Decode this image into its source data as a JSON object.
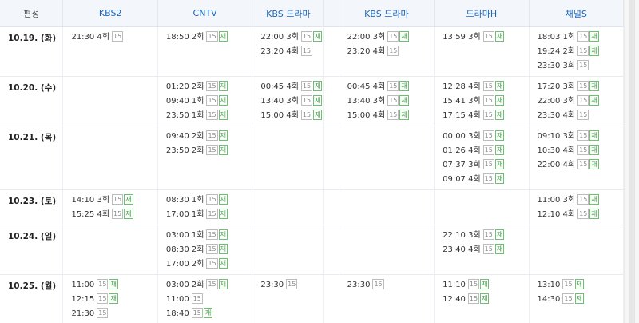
{
  "columns": [
    {
      "key": "date",
      "label": "편성"
    },
    {
      "key": "kbs2",
      "label": "KBS2"
    },
    {
      "key": "cntv",
      "label": "CNTV"
    },
    {
      "key": "kbsd1",
      "label": "KBS 드라마"
    },
    {
      "key": "kbsd2",
      "label": "KBS 드라마"
    },
    {
      "key": "dramah",
      "label": "드라마H"
    },
    {
      "key": "chs",
      "label": "채널S"
    }
  ],
  "rows": [
    {
      "date": "10.19. (화)",
      "height": 62,
      "cells": {
        "kbs2": [
          {
            "time": "21:30",
            "ep": "4회",
            "rating": "15",
            "rerun": false
          }
        ],
        "cntv": [
          {
            "time": "18:50",
            "ep": "2회",
            "rating": "15",
            "rerun": true
          }
        ],
        "kbsd1": [
          {
            "time": "22:00",
            "ep": "3회",
            "rating": "15",
            "rerun": true
          },
          {
            "time": "23:20",
            "ep": "4회",
            "rating": "15",
            "rerun": false
          }
        ],
        "kbsd2": [
          {
            "time": "22:00",
            "ep": "3회",
            "rating": "15",
            "rerun": true
          },
          {
            "time": "23:20",
            "ep": "4회",
            "rating": "15",
            "rerun": false
          }
        ],
        "dramah": [
          {
            "time": "13:59",
            "ep": "3회",
            "rating": "15",
            "rerun": true
          }
        ],
        "chs": [
          {
            "time": "18:03",
            "ep": "1회",
            "rating": "15",
            "rerun": true
          },
          {
            "time": "19:24",
            "ep": "2회",
            "rating": "15",
            "rerun": true
          },
          {
            "time": "23:30",
            "ep": "3회",
            "rating": "15",
            "rerun": false
          }
        ]
      }
    },
    {
      "date": "10.20. (수)",
      "height": 62,
      "cells": {
        "kbs2": [],
        "cntv": [
          {
            "time": "01:20",
            "ep": "2회",
            "rating": "15",
            "rerun": true
          },
          {
            "time": "09:40",
            "ep": "1회",
            "rating": "15",
            "rerun": true
          },
          {
            "time": "23:50",
            "ep": "1회",
            "rating": "15",
            "rerun": true
          }
        ],
        "kbsd1": [
          {
            "time": "00:45",
            "ep": "4회",
            "rating": "15",
            "rerun": true
          },
          {
            "time": "13:40",
            "ep": "3회",
            "rating": "15",
            "rerun": true
          },
          {
            "time": "15:00",
            "ep": "4회",
            "rating": "15",
            "rerun": true
          }
        ],
        "kbsd2": [
          {
            "time": "00:45",
            "ep": "4회",
            "rating": "15",
            "rerun": true
          },
          {
            "time": "13:40",
            "ep": "3회",
            "rating": "15",
            "rerun": true
          },
          {
            "time": "15:00",
            "ep": "4회",
            "rating": "15",
            "rerun": true
          }
        ],
        "dramah": [
          {
            "time": "12:28",
            "ep": "4회",
            "rating": "15",
            "rerun": true
          },
          {
            "time": "15:41",
            "ep": "3회",
            "rating": "15",
            "rerun": true
          },
          {
            "time": "17:15",
            "ep": "4회",
            "rating": "15",
            "rerun": true
          }
        ],
        "chs": [
          {
            "time": "17:20",
            "ep": "3회",
            "rating": "15",
            "rerun": true
          },
          {
            "time": "22:00",
            "ep": "3회",
            "rating": "15",
            "rerun": true
          },
          {
            "time": "23:30",
            "ep": "4회",
            "rating": "15",
            "rerun": false
          }
        ]
      }
    },
    {
      "date": "10.21. (목)",
      "height": 80,
      "cells": {
        "kbs2": [],
        "cntv": [
          {
            "time": "09:40",
            "ep": "2회",
            "rating": "15",
            "rerun": true
          },
          {
            "time": "23:50",
            "ep": "2회",
            "rating": "15",
            "rerun": true
          }
        ],
        "kbsd1": [],
        "kbsd2": [],
        "dramah": [
          {
            "time": "00:00",
            "ep": "3회",
            "rating": "15",
            "rerun": true
          },
          {
            "time": "01:26",
            "ep": "4회",
            "rating": "15",
            "rerun": true
          },
          {
            "time": "07:37",
            "ep": "3회",
            "rating": "15",
            "rerun": true
          },
          {
            "time": "09:07",
            "ep": "4회",
            "rating": "15",
            "rerun": true
          }
        ],
        "chs": [
          {
            "time": "09:10",
            "ep": "3회",
            "rating": "15",
            "rerun": true
          },
          {
            "time": "10:30",
            "ep": "4회",
            "rating": "15",
            "rerun": true
          },
          {
            "time": "22:00",
            "ep": "4회",
            "rating": "15",
            "rerun": true
          }
        ]
      }
    },
    {
      "date": "10.23. (토)",
      "height": 44,
      "cells": {
        "kbs2": [
          {
            "time": "14:10",
            "ep": "3회",
            "rating": "15",
            "rerun": true
          },
          {
            "time": "15:25",
            "ep": "4회",
            "rating": "15",
            "rerun": true
          }
        ],
        "cntv": [
          {
            "time": "08:30",
            "ep": "1회",
            "rating": "15",
            "rerun": true
          },
          {
            "time": "17:00",
            "ep": "1회",
            "rating": "15",
            "rerun": true
          }
        ],
        "kbsd1": [],
        "kbsd2": [],
        "dramah": [],
        "chs": [
          {
            "time": "11:00",
            "ep": "3회",
            "rating": "15",
            "rerun": true
          },
          {
            "time": "12:10",
            "ep": "4회",
            "rating": "15",
            "rerun": true
          }
        ]
      }
    },
    {
      "date": "10.24. (일)",
      "height": 62,
      "cells": {
        "kbs2": [],
        "cntv": [
          {
            "time": "03:00",
            "ep": "1회",
            "rating": "15",
            "rerun": true
          },
          {
            "time": "08:30",
            "ep": "2회",
            "rating": "15",
            "rerun": true
          },
          {
            "time": "17:00",
            "ep": "2회",
            "rating": "15",
            "rerun": true
          }
        ],
        "kbsd1": [],
        "kbsd2": [],
        "dramah": [
          {
            "time": "22:10",
            "ep": "3회",
            "rating": "15",
            "rerun": true
          },
          {
            "time": "23:40",
            "ep": "4회",
            "rating": "15",
            "rerun": true
          }
        ],
        "chs": []
      }
    },
    {
      "date": "10.25. (월)",
      "height": 62,
      "cells": {
        "kbs2": [
          {
            "time": "11:00",
            "ep": "",
            "rating": "15",
            "rerun": true
          },
          {
            "time": "12:15",
            "ep": "",
            "rating": "15",
            "rerun": true
          },
          {
            "time": "21:30",
            "ep": "",
            "rating": "15",
            "rerun": false
          }
        ],
        "cntv": [
          {
            "time": "03:00",
            "ep": "2회",
            "rating": "15",
            "rerun": true
          },
          {
            "time": "11:00",
            "ep": "",
            "rating": "15",
            "rerun": false
          },
          {
            "time": "18:40",
            "ep": "",
            "rating": "15",
            "rerun": true
          }
        ],
        "kbsd1": [
          {
            "time": "23:30",
            "ep": "",
            "rating": "15",
            "rerun": false
          }
        ],
        "kbsd2": [
          {
            "time": "23:30",
            "ep": "",
            "rating": "15",
            "rerun": false
          }
        ],
        "dramah": [
          {
            "time": "11:10",
            "ep": "",
            "rating": "15",
            "rerun": true
          },
          {
            "time": "12:40",
            "ep": "",
            "rating": "15",
            "rerun": true
          }
        ],
        "chs": [
          {
            "time": "13:10",
            "ep": "",
            "rating": "15",
            "rerun": true
          },
          {
            "time": "14:30",
            "ep": "",
            "rating": "15",
            "rerun": true
          }
        ]
      }
    }
  ],
  "rerun_label": "재",
  "colors": {
    "header_text": "#1a68c2",
    "header_bg": "#f3f7fc",
    "rerun": "#3f9e44",
    "rating_border": "#bcbcbc"
  }
}
